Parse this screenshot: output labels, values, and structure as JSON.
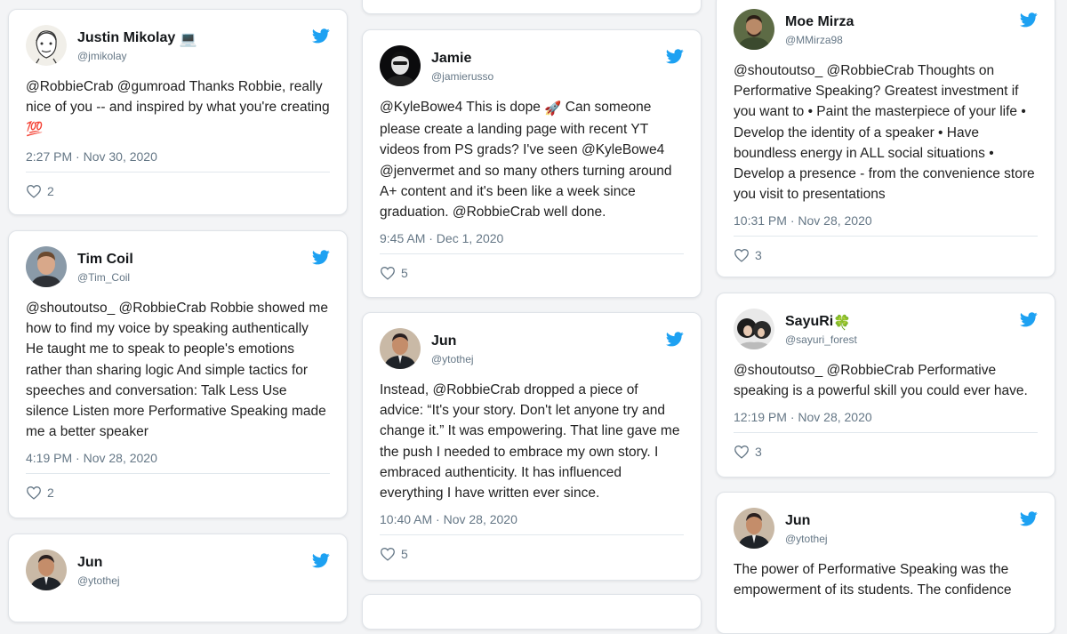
{
  "colors": {
    "twitter_blue": "#1da1f2",
    "muted": "#657786",
    "background": "#f3f4f6"
  },
  "icons": {
    "brand": "twitter-bird-icon",
    "like": "heart-outline-icon"
  },
  "tweets": [
    {
      "name": "Justin Mikolay",
      "name_emoji": "💻",
      "handle": "@jmikolay",
      "text": "@RobbieCrab @gumroad Thanks Robbie, really nice of you -- and inspired by what you're creating",
      "text_emoji": "💯",
      "time": "2:27 PM · Nov 30, 2020",
      "likes": "2"
    },
    {
      "name": "Tim Coil",
      "handle": "@Tim_Coil",
      "text": "@shoutoutso_ @RobbieCrab Robbie showed me how to find my voice by speaking authentically He taught me to speak to people's emotions rather than sharing logic And simple tactics for speeches and conversation: Talk Less Use silence Listen more Performative Speaking made me a better speaker",
      "time": "4:19 PM · Nov 28, 2020",
      "likes": "2"
    },
    {
      "name": "Jun",
      "handle": "@ytothej"
    },
    {
      "name": "Jamie",
      "handle": "@jamierusso",
      "text_before": "@KyleBowe4 This is dope ",
      "text_emoji": "🚀",
      "text_after": " Can someone please create a landing page with recent YT videos from PS grads? I've seen @KyleBowe4 @jenvermet and so many others turning around A+ content and it's been like a week since graduation. @RobbieCrab well done.",
      "time": "9:45 AM · Dec 1, 2020",
      "likes": "5"
    },
    {
      "name": "Jun",
      "handle": "@ytothej",
      "text": "Instead, @RobbieCrab dropped a piece of advice: “It's your story. Don't let anyone try and change it.” It was empowering. That line gave me the push I needed to embrace my own story. I embraced authenticity. It has influenced everything I have written ever since.",
      "time": "10:40 AM · Nov 28, 2020",
      "likes": "5"
    },
    {
      "name": "Moe Mirza",
      "handle": "@MMirza98",
      "text": "@shoutoutso_ @RobbieCrab Thoughts on Performative Speaking? Greatest investment if you want to • Paint the masterpiece of your life • Develop the identity of a speaker • Have boundless energy in ALL social situations • Develop a presence - from the convenience store you visit to presentations",
      "time": "10:31 PM · Nov 28, 2020",
      "likes": "3"
    },
    {
      "name": "SayuRi",
      "name_emoji": "🍀",
      "handle": "@sayuri_forest",
      "text": "@shoutoutso_ @RobbieCrab Performative speaking is a powerful skill you could ever have.",
      "time": "12:19 PM · Nov 28, 2020",
      "likes": "3"
    },
    {
      "name": "Jun",
      "handle": "@ytothej",
      "text": "The power of Performative Speaking was the empowerment of its students. The confidence"
    }
  ]
}
